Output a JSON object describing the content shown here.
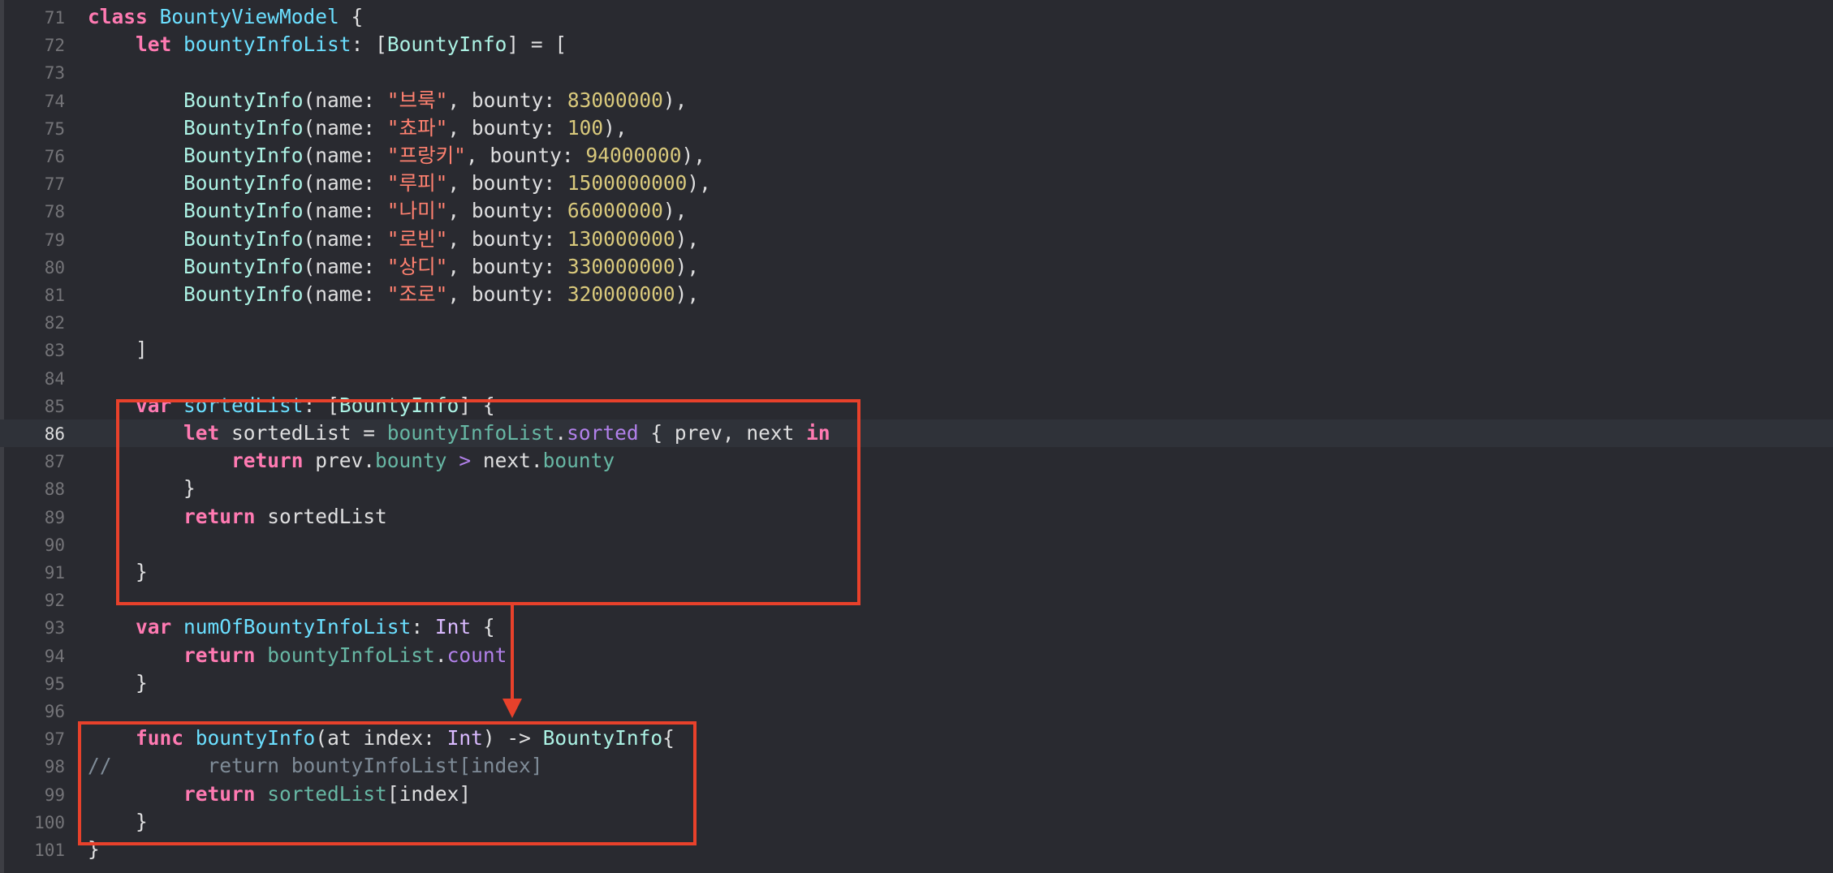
{
  "annotation_color": "#e8412b",
  "colors": {
    "background": "#292a30",
    "keyword": "#ff7ab2",
    "type": "#dabaff",
    "string": "#ff8170",
    "number": "#d9c97c",
    "comment": "#7f8c98"
  },
  "current_line": 86,
  "lines": [
    {
      "n": "71",
      "t": [
        [
          "kw",
          "class"
        ],
        [
          "plain",
          " "
        ],
        [
          "dcl",
          "BountyViewModel"
        ],
        [
          "plain",
          " {"
        ]
      ]
    },
    {
      "n": "72",
      "t": [
        [
          "plain",
          "    "
        ],
        [
          "kw",
          "let"
        ],
        [
          "plain",
          " "
        ],
        [
          "dcl",
          "bountyInfoList"
        ],
        [
          "plain",
          ": ["
        ],
        [
          "ty2",
          "BountyInfo"
        ],
        [
          "plain",
          "] = ["
        ]
      ]
    },
    {
      "n": "73",
      "t": []
    },
    {
      "n": "74",
      "t": [
        [
          "plain",
          "        "
        ],
        [
          "ty2",
          "BountyInfo"
        ],
        [
          "plain",
          "(name: "
        ],
        [
          "str",
          "\"브룩\""
        ],
        [
          "plain",
          ", bounty: "
        ],
        [
          "num",
          "83000000"
        ],
        [
          "plain",
          "),"
        ]
      ]
    },
    {
      "n": "75",
      "t": [
        [
          "plain",
          "        "
        ],
        [
          "ty2",
          "BountyInfo"
        ],
        [
          "plain",
          "(name: "
        ],
        [
          "str",
          "\"쵸파\""
        ],
        [
          "plain",
          ", bounty: "
        ],
        [
          "num",
          "100"
        ],
        [
          "plain",
          "),"
        ]
      ]
    },
    {
      "n": "76",
      "t": [
        [
          "plain",
          "        "
        ],
        [
          "ty2",
          "BountyInfo"
        ],
        [
          "plain",
          "(name: "
        ],
        [
          "str",
          "\"프랑키\""
        ],
        [
          "plain",
          ", bounty: "
        ],
        [
          "num",
          "94000000"
        ],
        [
          "plain",
          "),"
        ]
      ]
    },
    {
      "n": "77",
      "t": [
        [
          "plain",
          "        "
        ],
        [
          "ty2",
          "BountyInfo"
        ],
        [
          "plain",
          "(name: "
        ],
        [
          "str",
          "\"루피\""
        ],
        [
          "plain",
          ", bounty: "
        ],
        [
          "num",
          "1500000000"
        ],
        [
          "plain",
          "),"
        ]
      ]
    },
    {
      "n": "78",
      "t": [
        [
          "plain",
          "        "
        ],
        [
          "ty2",
          "BountyInfo"
        ],
        [
          "plain",
          "(name: "
        ],
        [
          "str",
          "\"나미\""
        ],
        [
          "plain",
          ", bounty: "
        ],
        [
          "num",
          "66000000"
        ],
        [
          "plain",
          "),"
        ]
      ]
    },
    {
      "n": "79",
      "t": [
        [
          "plain",
          "        "
        ],
        [
          "ty2",
          "BountyInfo"
        ],
        [
          "plain",
          "(name: "
        ],
        [
          "str",
          "\"로빈\""
        ],
        [
          "plain",
          ", bounty: "
        ],
        [
          "num",
          "130000000"
        ],
        [
          "plain",
          "),"
        ]
      ]
    },
    {
      "n": "80",
      "t": [
        [
          "plain",
          "        "
        ],
        [
          "ty2",
          "BountyInfo"
        ],
        [
          "plain",
          "(name: "
        ],
        [
          "str",
          "\"상디\""
        ],
        [
          "plain",
          ", bounty: "
        ],
        [
          "num",
          "330000000"
        ],
        [
          "plain",
          "),"
        ]
      ]
    },
    {
      "n": "81",
      "t": [
        [
          "plain",
          "        "
        ],
        [
          "ty2",
          "BountyInfo"
        ],
        [
          "plain",
          "(name: "
        ],
        [
          "str",
          "\"조로\""
        ],
        [
          "plain",
          ", bounty: "
        ],
        [
          "num",
          "320000000"
        ],
        [
          "plain",
          "),"
        ]
      ]
    },
    {
      "n": "82",
      "t": []
    },
    {
      "n": "83",
      "t": [
        [
          "plain",
          "    ]"
        ]
      ]
    },
    {
      "n": "84",
      "t": []
    },
    {
      "n": "85",
      "t": [
        [
          "plain",
          "    "
        ],
        [
          "kw",
          "var"
        ],
        [
          "plain",
          " "
        ],
        [
          "dcl",
          "sortedList"
        ],
        [
          "plain",
          ": ["
        ],
        [
          "ty2",
          "BountyInfo"
        ],
        [
          "plain",
          "] {"
        ]
      ]
    },
    {
      "n": "86",
      "t": [
        [
          "plain",
          "        "
        ],
        [
          "kw",
          "let"
        ],
        [
          "plain",
          " sortedList = "
        ],
        [
          "mem",
          "bountyInfoList"
        ],
        [
          "plain",
          "."
        ],
        [
          "mth",
          "sorted"
        ],
        [
          "plain",
          " { prev, next "
        ],
        [
          "kw",
          "in"
        ]
      ]
    },
    {
      "n": "87",
      "t": [
        [
          "plain",
          "            "
        ],
        [
          "kw",
          "return"
        ],
        [
          "plain",
          " prev."
        ],
        [
          "mem",
          "bounty"
        ],
        [
          "plain",
          " "
        ],
        [
          "op",
          ">"
        ],
        [
          "plain",
          " next."
        ],
        [
          "mem",
          "bounty"
        ]
      ]
    },
    {
      "n": "88",
      "t": [
        [
          "plain",
          "        }"
        ]
      ]
    },
    {
      "n": "89",
      "t": [
        [
          "plain",
          "        "
        ],
        [
          "kw",
          "return"
        ],
        [
          "plain",
          " sortedList"
        ]
      ]
    },
    {
      "n": "90",
      "t": []
    },
    {
      "n": "91",
      "t": [
        [
          "plain",
          "    }"
        ]
      ]
    },
    {
      "n": "92",
      "t": []
    },
    {
      "n": "93",
      "t": [
        [
          "plain",
          "    "
        ],
        [
          "kw",
          "var"
        ],
        [
          "plain",
          " "
        ],
        [
          "dcl",
          "numOfBountyInfoList"
        ],
        [
          "plain",
          ": "
        ],
        [
          "ty",
          "Int"
        ],
        [
          "plain",
          " {"
        ]
      ]
    },
    {
      "n": "94",
      "t": [
        [
          "plain",
          "        "
        ],
        [
          "kw",
          "return"
        ],
        [
          "plain",
          " "
        ],
        [
          "mem",
          "bountyInfoList"
        ],
        [
          "plain",
          "."
        ],
        [
          "mth",
          "count"
        ]
      ]
    },
    {
      "n": "95",
      "t": [
        [
          "plain",
          "    }"
        ]
      ]
    },
    {
      "n": "96",
      "t": []
    },
    {
      "n": "97",
      "t": [
        [
          "plain",
          "    "
        ],
        [
          "kw",
          "func"
        ],
        [
          "plain",
          " "
        ],
        [
          "dcl",
          "bountyInfo"
        ],
        [
          "plain",
          "(at index: "
        ],
        [
          "ty",
          "Int"
        ],
        [
          "plain",
          ") -> "
        ],
        [
          "ty2",
          "BountyInfo"
        ],
        [
          "plain",
          "{"
        ]
      ]
    },
    {
      "n": "98",
      "t": [
        [
          "cmt",
          "//        return bountyInfoList[index]"
        ]
      ]
    },
    {
      "n": "99",
      "t": [
        [
          "plain",
          "        "
        ],
        [
          "kw",
          "return"
        ],
        [
          "plain",
          " "
        ],
        [
          "mem",
          "sortedList"
        ],
        [
          "plain",
          "[index]"
        ]
      ]
    },
    {
      "n": "100",
      "t": [
        [
          "plain",
          "    }"
        ]
      ]
    },
    {
      "n": "101",
      "t": [
        [
          "plain",
          "}"
        ]
      ]
    }
  ]
}
